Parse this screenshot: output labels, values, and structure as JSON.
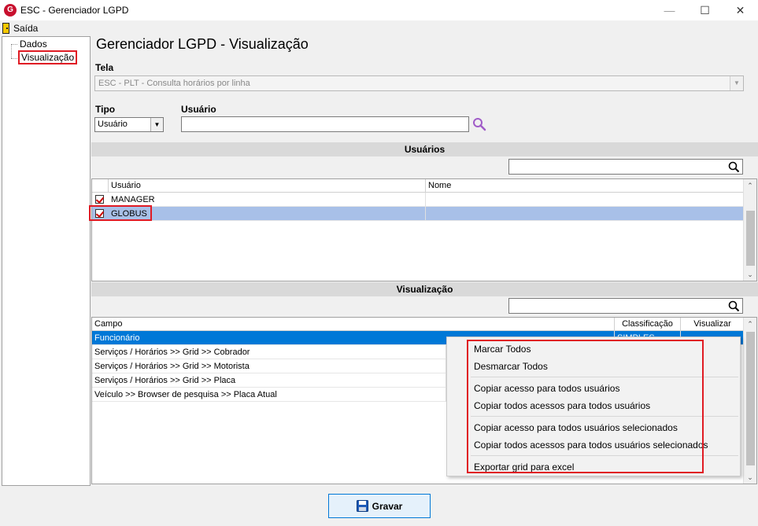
{
  "window": {
    "title": "ESC - Gerenciador LGPD",
    "app_icon": "G"
  },
  "menu": {
    "exit_label": "Saída"
  },
  "tree": {
    "items": [
      {
        "label": "Dados"
      },
      {
        "label": "Visualização"
      }
    ]
  },
  "main": {
    "title": "Gerenciador LGPD - Visualização",
    "tela_label": "Tela",
    "tela_value": "ESC - PLT - Consulta horários por linha",
    "tipo_label": "Tipo",
    "tipo_value": "Usuário",
    "usuario_label": "Usuário",
    "usuario_value": ""
  },
  "usuarios_section": {
    "header": "Usuários",
    "columns": [
      "Usuário",
      "Nome"
    ],
    "rows": [
      {
        "usuario": "MANAGER",
        "nome": "",
        "checked": true
      },
      {
        "usuario": "GLOBUS",
        "nome": "",
        "checked": true,
        "selected": true
      }
    ]
  },
  "visualizacao_section": {
    "header": "Visualização",
    "columns": [
      "Campo",
      "Classificação",
      "Visualizar"
    ],
    "rows": [
      {
        "campo": "Funcionário",
        "classificacao": "SIMPLES",
        "selected": true
      },
      {
        "campo": "Serviços / Horários >> Grid >> Cobrador"
      },
      {
        "campo": "Serviços / Horários >> Grid >> Motorista"
      },
      {
        "campo": "Serviços / Horários >> Grid >> Placa"
      },
      {
        "campo": "Veículo >> Browser de pesquisa >> Placa Atual"
      }
    ]
  },
  "context_menu": {
    "items": [
      "Marcar Todos",
      "Desmarcar Todos",
      "Copiar acesso para todos usuários",
      "Copiar todos acessos para todos usuários",
      "Copiar acesso para todos usuários selecionados",
      "Copiar todos acessos para todos usuários selecionados",
      "Exportar grid para excel"
    ]
  },
  "footer": {
    "save_label": "Gravar"
  },
  "colors": {
    "selection": "#a8c0e8",
    "active_selection": "#0078d7",
    "highlight_outline": "#e01b24"
  }
}
